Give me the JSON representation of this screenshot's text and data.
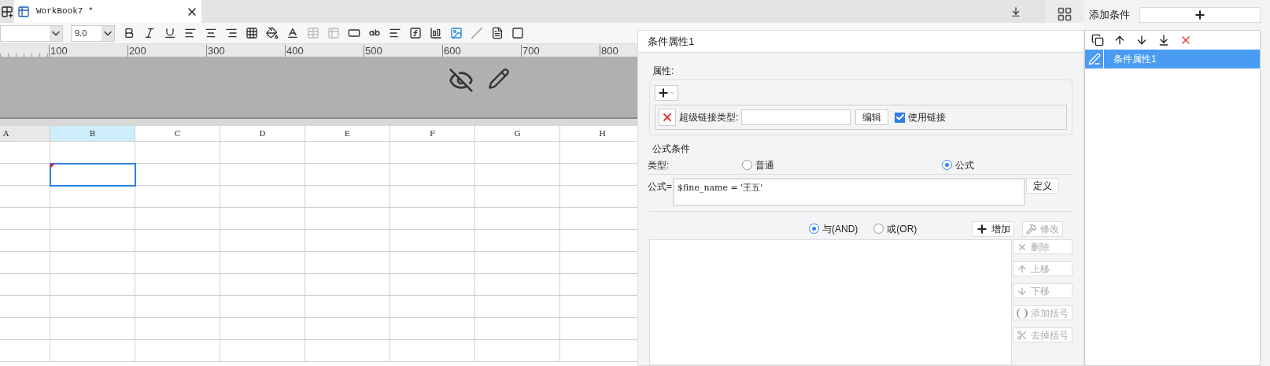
{
  "tab": {
    "title": "WorkBook7 *"
  },
  "toolbar": {
    "font_size": "9.0"
  },
  "ruler": [
    "100",
    "200",
    "300",
    "400",
    "500",
    "600",
    "700",
    "800"
  ],
  "columns": [
    {
      "label": "A",
      "selected": false
    },
    {
      "label": "B",
      "selected": true
    },
    {
      "label": "C",
      "selected": false
    },
    {
      "label": "D",
      "selected": false
    },
    {
      "label": "E",
      "selected": false
    },
    {
      "label": "F",
      "selected": false
    },
    {
      "label": "G",
      "selected": false
    },
    {
      "label": "H",
      "selected": false
    }
  ],
  "dialog": {
    "title": "条件属性1",
    "attributes": {
      "legend": "属性:",
      "hyperlink_label": "超级链接类型:",
      "edit_button": "编辑",
      "use_link": {
        "label": "使用链接",
        "checked": true
      }
    },
    "formula_condition": {
      "legend": "公式条件",
      "type_label": "类型:",
      "types": [
        {
          "label": "普通",
          "selected": false
        },
        {
          "label": "公式",
          "selected": true
        }
      ],
      "formula_label": "公式=",
      "formula": "$fine_name = '王五'",
      "define_button": "定义",
      "logic": [
        {
          "label": "与(AND)",
          "selected": true
        },
        {
          "label": "或(OR)",
          "selected": false
        }
      ],
      "add_button": {
        "label": "增加",
        "disabled": false
      },
      "modify_button": {
        "label": "修改",
        "disabled": true
      },
      "side_buttons": [
        {
          "label": "删除",
          "kind": "delete",
          "disabled": true
        },
        {
          "label": "上移",
          "kind": "up",
          "disabled": true
        },
        {
          "label": "下移",
          "kind": "down",
          "disabled": true
        },
        {
          "label": "添加括号",
          "kind": "add_paren",
          "disabled": true
        },
        {
          "label": "去掉括号",
          "kind": "remove_paren",
          "disabled": true
        }
      ]
    }
  },
  "conditions_panel": {
    "add_label": "添加条件",
    "items": [
      {
        "label": "条件属性1",
        "selected": true
      }
    ]
  }
}
